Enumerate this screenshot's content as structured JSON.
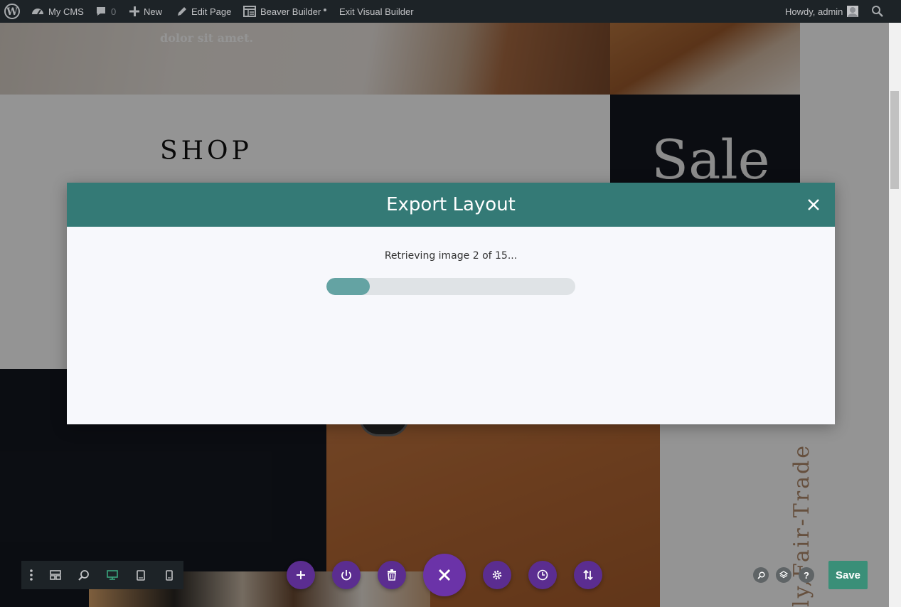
{
  "adminbar": {
    "site_name": "My CMS",
    "comments_count": "0",
    "new_label": "New",
    "edit_page_label": "Edit Page",
    "builder_label": "Beaver Builder",
    "exit_label": "Exit Visual Builder",
    "howdy_label": "Howdy, admin"
  },
  "page": {
    "hero_text": "dolor sit amet.",
    "shop_heading": "SHOP",
    "sale_heading": "Sale",
    "vertical_text": "ly,Fair-Trade"
  },
  "modal": {
    "title": "Export Layout",
    "status": "Retrieving image 2 of 15...",
    "progress_fraction": 0.1333
  },
  "save_label": "Save",
  "help_glyph": "?",
  "colors": {
    "header_teal": "#347a76",
    "progress_fill": "#64a3a3",
    "toolbar_purple": "#5b2d90",
    "save_green": "#3a8f78"
  }
}
